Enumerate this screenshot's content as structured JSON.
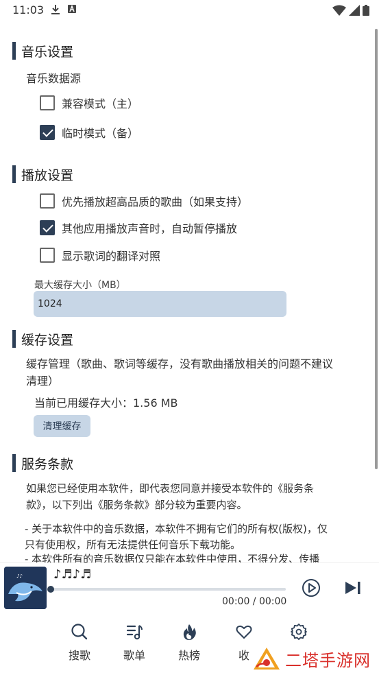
{
  "status_bar": {
    "time": "11:03"
  },
  "music_settings": {
    "title": "音乐设置",
    "source_label": "音乐数据源",
    "options": [
      {
        "label": "兼容模式（主）",
        "checked": false
      },
      {
        "label": "临时模式（备）",
        "checked": true
      }
    ]
  },
  "play_settings": {
    "title": "播放设置",
    "options": [
      {
        "label": "优先播放超高品质的歌曲（如果支持）",
        "checked": false
      },
      {
        "label": "其他应用播放声音时，自动暂停播放",
        "checked": true
      },
      {
        "label": "显示歌词的翻译对照",
        "checked": false
      }
    ],
    "cache_size_label": "最大缓存大小（MB）",
    "cache_size_value": "1024"
  },
  "cache_settings": {
    "title": "缓存设置",
    "description_line1": "缓存管理（歌曲、歌词等缓存，没有歌曲播放相关的问题不建议",
    "description_line2": "清理）",
    "current_usage": "当前已用缓存大小：1.56 MB",
    "clear_button": "清理缓存"
  },
  "terms": {
    "title": "服务条款",
    "intro_line1": "如果您已经使用本软件，即代表您同意并接受本软件的《服务条",
    "intro_line2": "款》，以下列出《服务条款》部分较为重要内容。",
    "item1_line1": "- 关于本软件中的音乐数据，本软件不拥有它们的所有权(版权)，仅",
    "item1_line2": "只有使用权，所有无法提供任何音乐下载功能。",
    "item2_line1": "- 本软件所有的音乐数据仅只能在本软件中使用，不得分发、传播"
  },
  "player": {
    "song_title": "♪♬♪♬",
    "time": "00:00 / 00:00",
    "progress": 0
  },
  "bottom_nav": [
    {
      "label": "搜歌",
      "icon": "search-icon"
    },
    {
      "label": "歌单",
      "icon": "playlist-icon"
    },
    {
      "label": "热榜",
      "icon": "fire-icon"
    },
    {
      "label": "收",
      "icon": "heart-icon"
    },
    {
      "label": "",
      "icon": "gear-icon"
    }
  ],
  "watermark": {
    "text": "二塔手游网"
  },
  "colors": {
    "accent": "#2d3f56",
    "field_bg": "#c7d6e6",
    "watermark": "#d9302b"
  }
}
